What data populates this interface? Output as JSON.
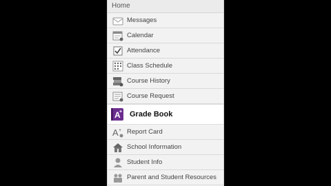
{
  "menu": {
    "home_label": "Home",
    "items": [
      {
        "label": "Messages",
        "icon": "envelope-icon"
      },
      {
        "label": "Calendar",
        "icon": "calendar-icon"
      },
      {
        "label": "Attendance",
        "icon": "attendance-checkbox-icon"
      },
      {
        "label": "Class Schedule",
        "icon": "schedule-grid-icon"
      },
      {
        "label": "Course History",
        "icon": "books-stack-icon"
      },
      {
        "label": "Course Request",
        "icon": "course-request-icon"
      },
      {
        "label": "Grade Book",
        "icon": "gradebook-a-plus-icon",
        "active": true
      },
      {
        "label": "Report Card",
        "icon": "report-card-a-plus-icon"
      },
      {
        "label": "School Information",
        "icon": "school-house-icon"
      },
      {
        "label": "Student Info",
        "icon": "student-person-icon"
      },
      {
        "label": "Parent and Student Resources",
        "icon": "people-icon"
      }
    ]
  },
  "colors": {
    "menu_bg": "#f2f2f2",
    "active_bg": "#ffffff",
    "gradebook_icon": "#6b2d8f",
    "icon_gray": "#8a8a8a",
    "background": "#000000"
  }
}
